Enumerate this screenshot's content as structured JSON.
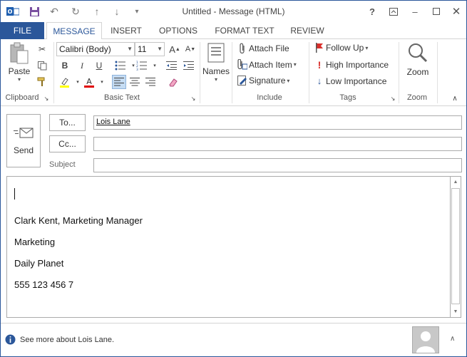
{
  "window": {
    "title": "Untitled - Message (HTML)",
    "help_label": "?",
    "accent_color": "#2b579a"
  },
  "tabs": [
    {
      "label": "FILE"
    },
    {
      "label": "MESSAGE"
    },
    {
      "label": "INSERT"
    },
    {
      "label": "OPTIONS"
    },
    {
      "label": "FORMAT TEXT"
    },
    {
      "label": "REVIEW"
    }
  ],
  "ribbon": {
    "clipboard": {
      "paste_label": "Paste",
      "group_label": "Clipboard"
    },
    "basic_text": {
      "font_name": "Calibri (Body)",
      "font_size": "11",
      "group_label": "Basic Text"
    },
    "names": {
      "label": "Names"
    },
    "include": {
      "attach_file": "Attach File",
      "attach_item": "Attach Item",
      "signature": "Signature",
      "group_label": "Include"
    },
    "tags": {
      "follow_up": "Follow Up",
      "high_importance": "High Importance",
      "low_importance": "Low Importance",
      "group_label": "Tags"
    },
    "zoom": {
      "label": "Zoom",
      "group_label": "Zoom"
    }
  },
  "header": {
    "send_label": "Send",
    "to_label": "To...",
    "to_value": "Lois Lane",
    "cc_label": "Cc...",
    "cc_value": "",
    "subject_label": "Subject",
    "subject_value": ""
  },
  "body": {
    "lines": [
      "Clark Kent, Marketing Manager",
      "Marketing",
      "Daily Planet",
      "555 123 456 7"
    ]
  },
  "status": {
    "people_text": "See more about Lois Lane."
  }
}
